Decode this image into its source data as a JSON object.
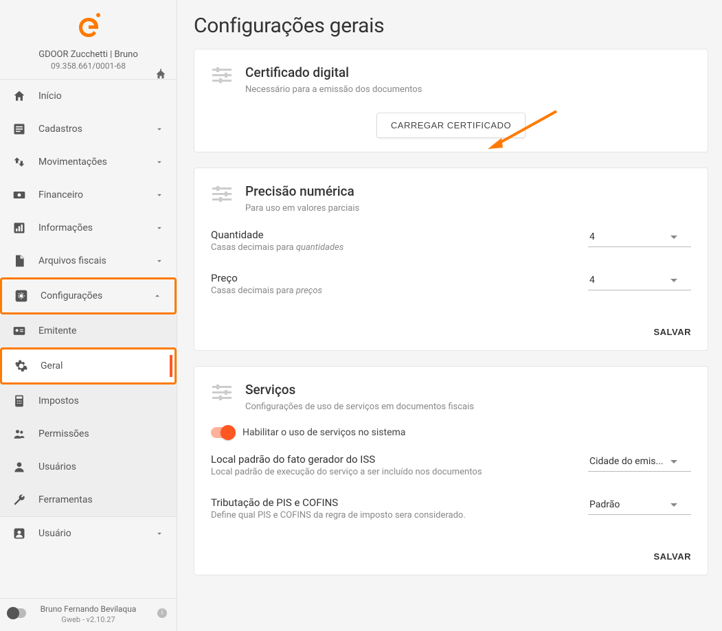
{
  "company": {
    "name": "GDOOR Zucchetti | Bruno",
    "id": "09.358.661/0001-68"
  },
  "nav": {
    "inicio": "Início",
    "cadastros": "Cadastros",
    "movimentacoes": "Movimentações",
    "financeiro": "Financeiro",
    "informacoes": "Informações",
    "arquivos": "Arquivos fiscais",
    "configuracoes": "Configurações",
    "emitente": "Emitente",
    "geral": "Geral",
    "impostos": "Impostos",
    "permissoes": "Permissões",
    "usuarios": "Usuários",
    "ferramentas": "Ferramentas",
    "usuario": "Usuário"
  },
  "footer": {
    "user": "Bruno Fernando Bevilaqua",
    "version": "Gweb - v2.10.27"
  },
  "page": {
    "title": "Configurações gerais"
  },
  "cert": {
    "title": "Certificado digital",
    "sub": "Necessário para a emissão dos documentos",
    "button": "CARREGAR CERTIFICADO"
  },
  "precision": {
    "title": "Precisão numérica",
    "sub": "Para uso em valores parciais",
    "qty_label": "Quantidade",
    "qty_desc_pre": "Casas decimais para ",
    "qty_desc_em": "quantidades",
    "qty_value": "4",
    "price_label": "Preço",
    "price_desc_pre": "Casas decimais para ",
    "price_desc_em": "preços",
    "price_value": "4",
    "save": "SALVAR"
  },
  "services": {
    "title": "Serviços",
    "sub": "Configurações de uso de serviços em documentos fiscais",
    "toggle_label": "Habilitar o uso de serviços no sistema",
    "iss_label": "Local padrão do fato gerador do ISS",
    "iss_desc": "Local padrão de execução do serviço a ser incluído nos documentos",
    "iss_value": "Cidade do emis...",
    "pis_label": "Tributação de PIS e COFINS",
    "pis_desc": "Define qual PIS e COFINS da regra de imposto sera considerado.",
    "pis_value": "Padrão",
    "save": "SALVAR"
  }
}
